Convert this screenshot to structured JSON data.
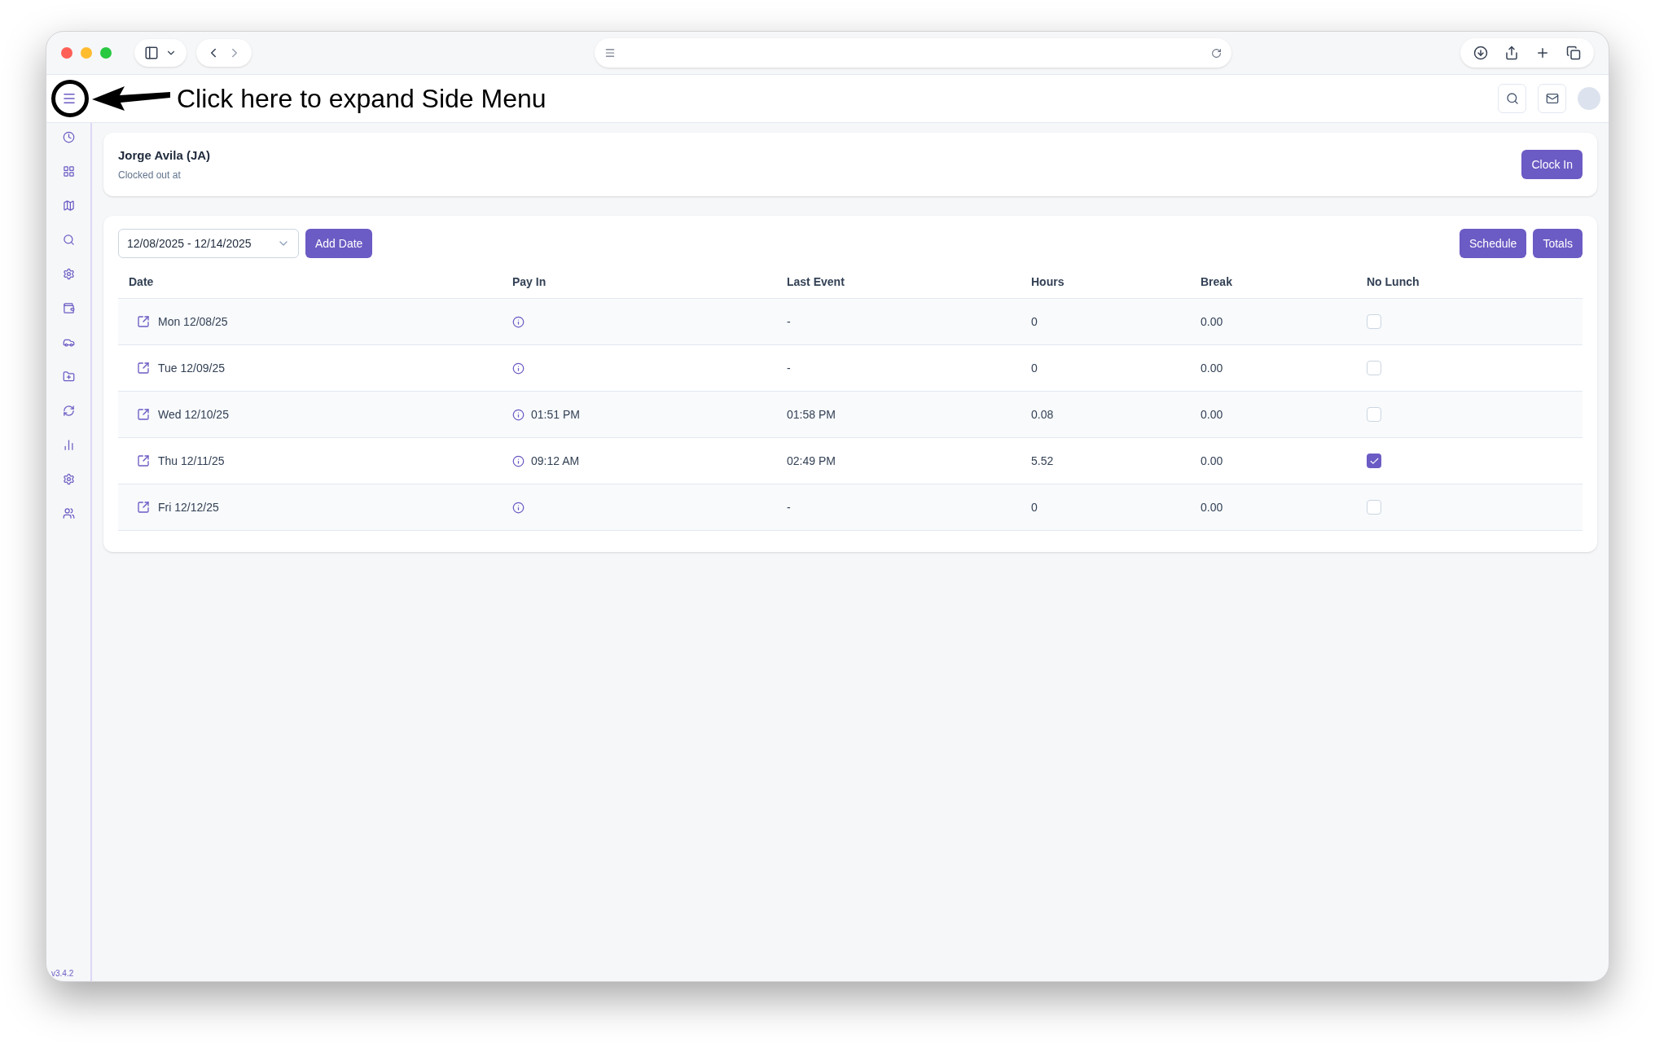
{
  "annotation": {
    "text": "Click here to expand Side Menu"
  },
  "employee": {
    "name": "Jorge Avila (JA)",
    "status": "Clocked out at",
    "action": "Clock In"
  },
  "toolbar": {
    "date_range": "12/08/2025 - 12/14/2025",
    "add_button": "Add Date",
    "buttons": [
      "Schedule",
      "Totals"
    ]
  },
  "table": {
    "columns": [
      "Date",
      "Pay In",
      "Last Event",
      "Hours",
      "Break",
      "No Lunch"
    ],
    "rows": [
      {
        "date": "Mon 12/08/25",
        "pay_in": "",
        "last_event": "-",
        "hours": "0",
        "break": "0.00",
        "no_lunch": false
      },
      {
        "date": "Tue 12/09/25",
        "pay_in": "",
        "last_event": "-",
        "hours": "0",
        "break": "0.00",
        "no_lunch": false
      },
      {
        "date": "Wed 12/10/25",
        "pay_in": "01:51 PM",
        "last_event": "01:58 PM",
        "hours": "0.08",
        "break": "0.00",
        "no_lunch": false
      },
      {
        "date": "Thu 12/11/25",
        "pay_in": "09:12 AM",
        "last_event": "02:49 PM",
        "hours": "5.52",
        "break": "0.00",
        "no_lunch": true
      },
      {
        "date": "Fri 12/12/25",
        "pay_in": "",
        "last_event": "-",
        "hours": "0",
        "break": "0.00",
        "no_lunch": false
      }
    ]
  },
  "version": "v3.4.2"
}
